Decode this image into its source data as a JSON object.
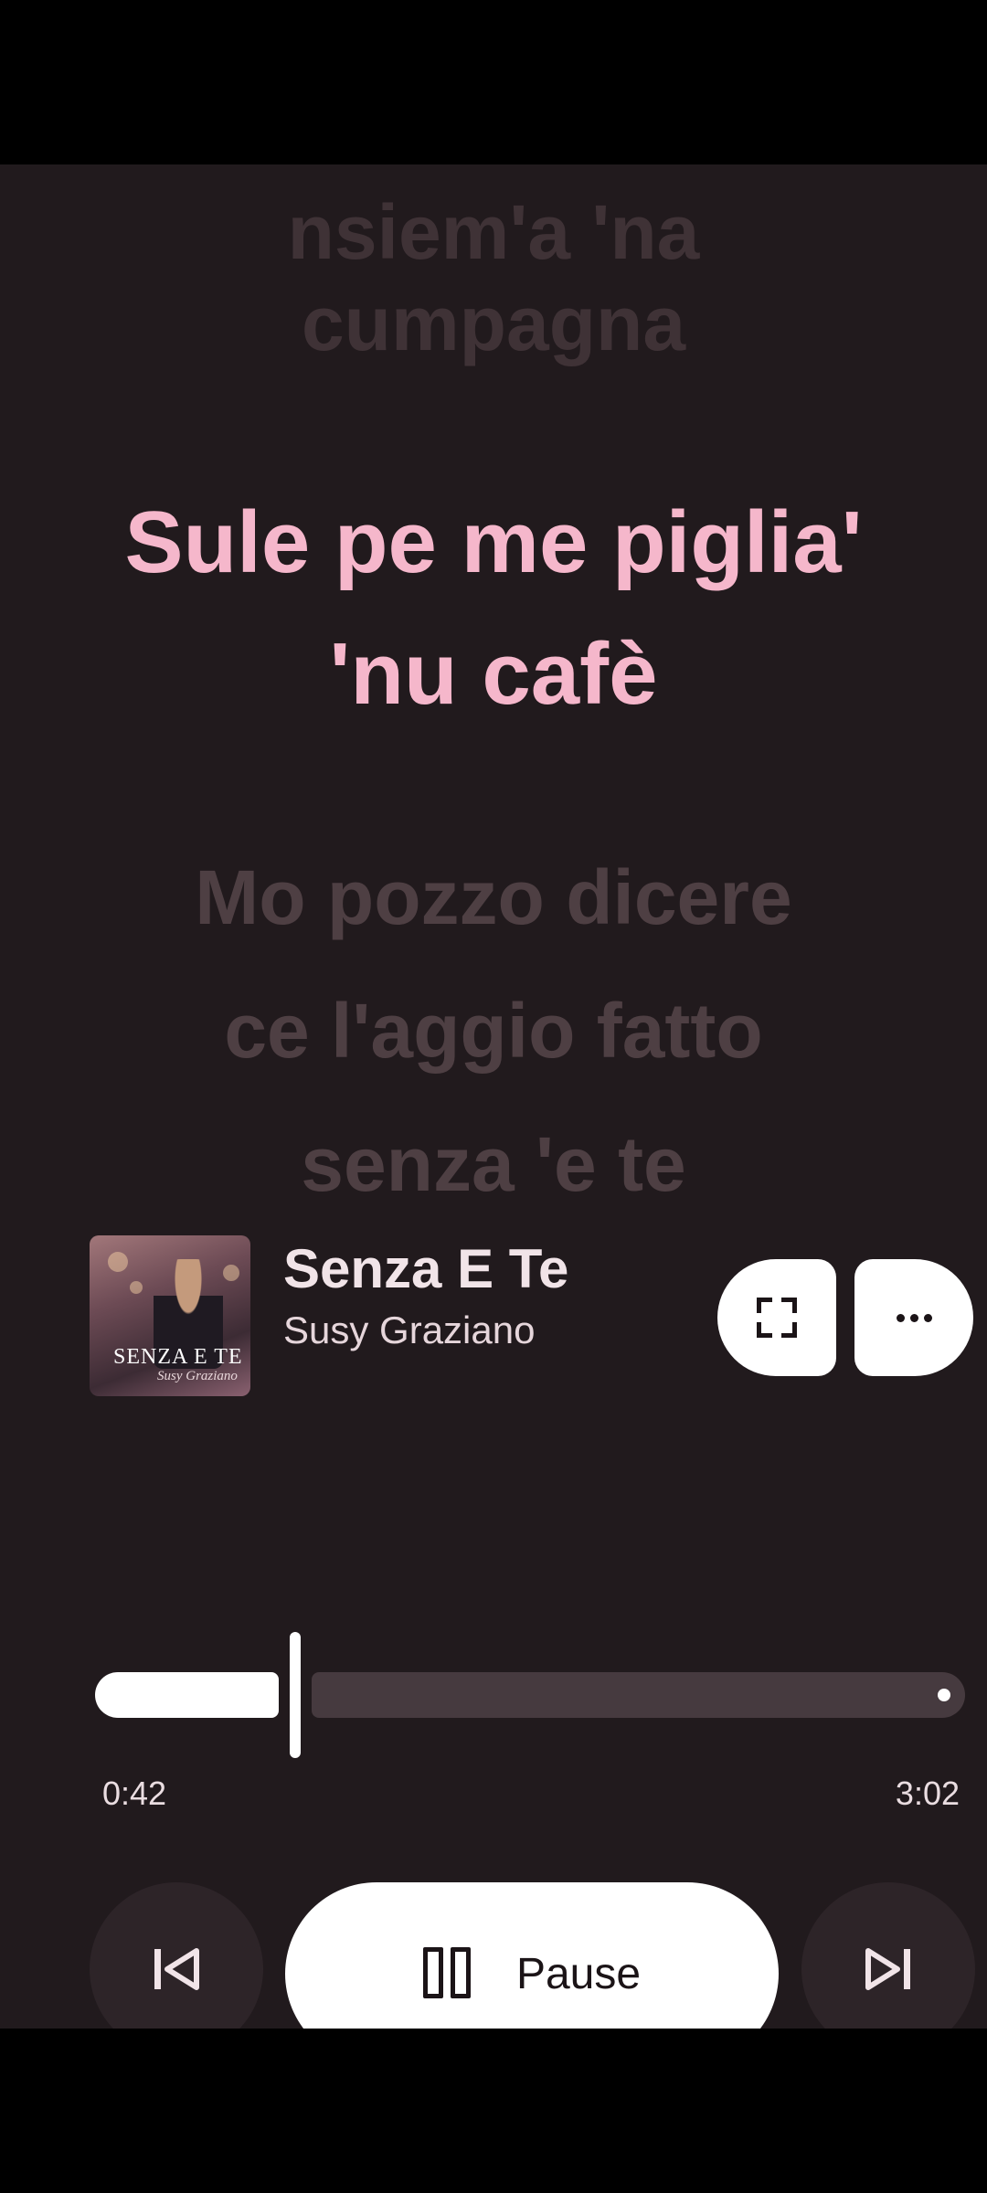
{
  "lyrics": {
    "previous_line_1": "nsiem'a 'na",
    "previous_line_2": "cumpagna",
    "current_line_1": "Sule pe me piglia'",
    "current_line_2": "'nu cafè",
    "next_line_1": "Mo pozzo dicere",
    "next_line_2": "ce l'aggio fatto",
    "next_line_3": "senza 'e te"
  },
  "now_playing": {
    "album_art_text": "SENZA E TE",
    "album_art_signature": "Susy Graziano",
    "title": "Senza E Te",
    "artist": "Susy Graziano"
  },
  "progress": {
    "elapsed": "0:42",
    "total": "3:02",
    "fraction": 0.23
  },
  "controls": {
    "pause_label": "Pause"
  },
  "icons": {
    "expand": "expand-icon",
    "more": "more-options-icon",
    "previous": "skip-previous-icon",
    "pause": "pause-icon",
    "next": "skip-next-icon"
  },
  "colors": {
    "background": "#211a1d",
    "active_lyric": "#f5b7cb",
    "inactive_lyric": "#4e3f43"
  }
}
